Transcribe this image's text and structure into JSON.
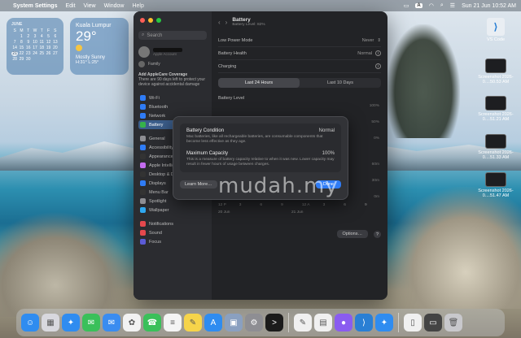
{
  "menubar": {
    "apple": "",
    "app": "System Settings",
    "items": [
      "Edit",
      "View",
      "Window",
      "Help"
    ],
    "right": {
      "input_badge": "A",
      "datetime": "Sun 21 Jun  10:52 AM"
    }
  },
  "calendar": {
    "month": "JUNE",
    "weekdays": [
      "S",
      "M",
      "T",
      "W",
      "T",
      "F",
      "S"
    ],
    "rows": [
      [
        "",
        "1",
        "2",
        "3",
        "4",
        "5",
        "6"
      ],
      [
        "7",
        "8",
        "9",
        "10",
        "11",
        "12",
        "13"
      ],
      [
        "14",
        "15",
        "16",
        "17",
        "18",
        "19",
        "20"
      ],
      [
        "21",
        "22",
        "23",
        "24",
        "25",
        "26",
        "27"
      ],
      [
        "28",
        "29",
        "30",
        "",
        "",
        "",
        ""
      ]
    ],
    "today": "21"
  },
  "weather": {
    "city": "Kuala Lumpur",
    "temp": "29°",
    "condition": "Mostly Sunny",
    "hilo": "H:31° L:25°"
  },
  "window": {
    "sidebar": {
      "search_placeholder": "Search",
      "account_sub": "Apple Account",
      "family": "Family",
      "ai_title": "Add AppleCare Coverage",
      "ai_text": "There are 90 days left to protect your device against accidental damage",
      "items": [
        {
          "label": "Wi-Fi",
          "color": "#2f7cf6"
        },
        {
          "label": "Bluetooth",
          "color": "#2f7cf6"
        },
        {
          "label": "Network",
          "color": "#2f7cf6"
        },
        {
          "label": "Battery",
          "color": "#36b24a",
          "selected": true
        }
      ],
      "items2": [
        {
          "label": "General",
          "color": "#8e8e93"
        },
        {
          "label": "Accessibility",
          "color": "#2f7cf6"
        },
        {
          "label": "Appearance",
          "color": "#333"
        },
        {
          "label": "Apple Intelligence",
          "color": "#c46cf0"
        },
        {
          "label": "Desktop & Dock",
          "color": "#333"
        },
        {
          "label": "Displays",
          "color": "#2f7cf6"
        },
        {
          "label": "Menu Bar",
          "color": "#333"
        },
        {
          "label": "Spotlight",
          "color": "#8e8e93"
        },
        {
          "label": "Wallpaper",
          "color": "#2fa8f0"
        }
      ],
      "items3": [
        {
          "label": "Notifications",
          "color": "#e5484d"
        },
        {
          "label": "Sound",
          "color": "#e5484d"
        },
        {
          "label": "Focus",
          "color": "#5b5bd6"
        }
      ]
    },
    "main": {
      "title": "Battery",
      "subtitle": "Battery Level: 82%",
      "rows": [
        {
          "label": "Low Power Mode",
          "value": "Never"
        },
        {
          "label": "Battery Health",
          "value": "Normal"
        },
        {
          "label": "Charging",
          "value": ""
        }
      ],
      "tabs": [
        "Last 24 Hours",
        "Last 10 Days"
      ],
      "section": "Battery Level",
      "ticks": [
        "100%",
        "50%",
        "0%"
      ],
      "usage_ticks": [
        "60m",
        "30m",
        "0m"
      ],
      "x_labels": [
        "12 P",
        "3",
        "6",
        "9",
        "12 A",
        "3",
        "6",
        "9"
      ],
      "x_dates": [
        "20 Jun",
        "21 Jun"
      ],
      "options": "Options…",
      "help": "?"
    }
  },
  "dialog": {
    "condition_label": "Battery Condition",
    "condition_value": "Normal",
    "condition_desc": "Mac batteries, like all rechargeable batteries, are consumable components that become less effective as they age.",
    "capacity_label": "Maximum Capacity",
    "capacity_value": "100%",
    "capacity_desc": "This is a measure of battery capacity relative to when it was new. Lower capacity may result in fewer hours of usage between charges.",
    "learn_more": "Learn More…",
    "done": "Done"
  },
  "watermark": "mudah.my",
  "desktop": [
    {
      "label": "VS Code",
      "type": "vscode"
    },
    {
      "label": "Screenshot 2026-0....50.53 AM",
      "type": "shot"
    },
    {
      "label": "Screenshot 2026-0....51.21 AM",
      "type": "shot"
    },
    {
      "label": "Screenshot 2026-0....51.33 AM",
      "type": "shot"
    },
    {
      "label": "Screenshot 2026-0....51.47 AM",
      "type": "shot"
    }
  ],
  "dock": [
    {
      "name": "finder",
      "color": "#2f8cf0",
      "glyph": "☺"
    },
    {
      "name": "launchpad",
      "color": "#d8d8de",
      "glyph": "▦"
    },
    {
      "name": "safari",
      "color": "#2f8cf0",
      "glyph": "✦"
    },
    {
      "name": "messages",
      "color": "#3ac05a",
      "glyph": "✉"
    },
    {
      "name": "mail",
      "color": "#3a8cf0",
      "glyph": "✉"
    },
    {
      "name": "photos",
      "color": "#f2f2f2",
      "glyph": "✿"
    },
    {
      "name": "facetime",
      "color": "#3ac05a",
      "glyph": "☎"
    },
    {
      "name": "reminders",
      "color": "#f4f4f4",
      "glyph": "≡"
    },
    {
      "name": "notes",
      "color": "#f6d44a",
      "glyph": "✎"
    },
    {
      "name": "app-store",
      "color": "#2f8cf0",
      "glyph": "A"
    },
    {
      "name": "preview",
      "color": "#8aa0c0",
      "glyph": "▣"
    },
    {
      "name": "system-settings",
      "color": "#8e8e93",
      "glyph": "⚙"
    },
    {
      "name": "terminal",
      "color": "#1b1b1b",
      "glyph": ">"
    },
    {
      "name": "sep"
    },
    {
      "name": "textedit",
      "color": "#f0f0f0",
      "glyph": "✎"
    },
    {
      "name": "calendar",
      "color": "#f0f0f0",
      "glyph": "▤"
    },
    {
      "name": "siri",
      "color": "#8a5cf0",
      "glyph": "●"
    },
    {
      "name": "vscode",
      "color": "#2a7fd4",
      "glyph": "⟩"
    },
    {
      "name": "safari-2",
      "color": "#2f8cf0",
      "glyph": "✦"
    },
    {
      "name": "sep"
    },
    {
      "name": "document",
      "color": "#f0f0f0",
      "glyph": "▯"
    },
    {
      "name": "screenshot",
      "color": "#444",
      "glyph": "▭"
    },
    {
      "name": "trash",
      "color": "#c8c8cc",
      "glyph": "🗑"
    }
  ]
}
